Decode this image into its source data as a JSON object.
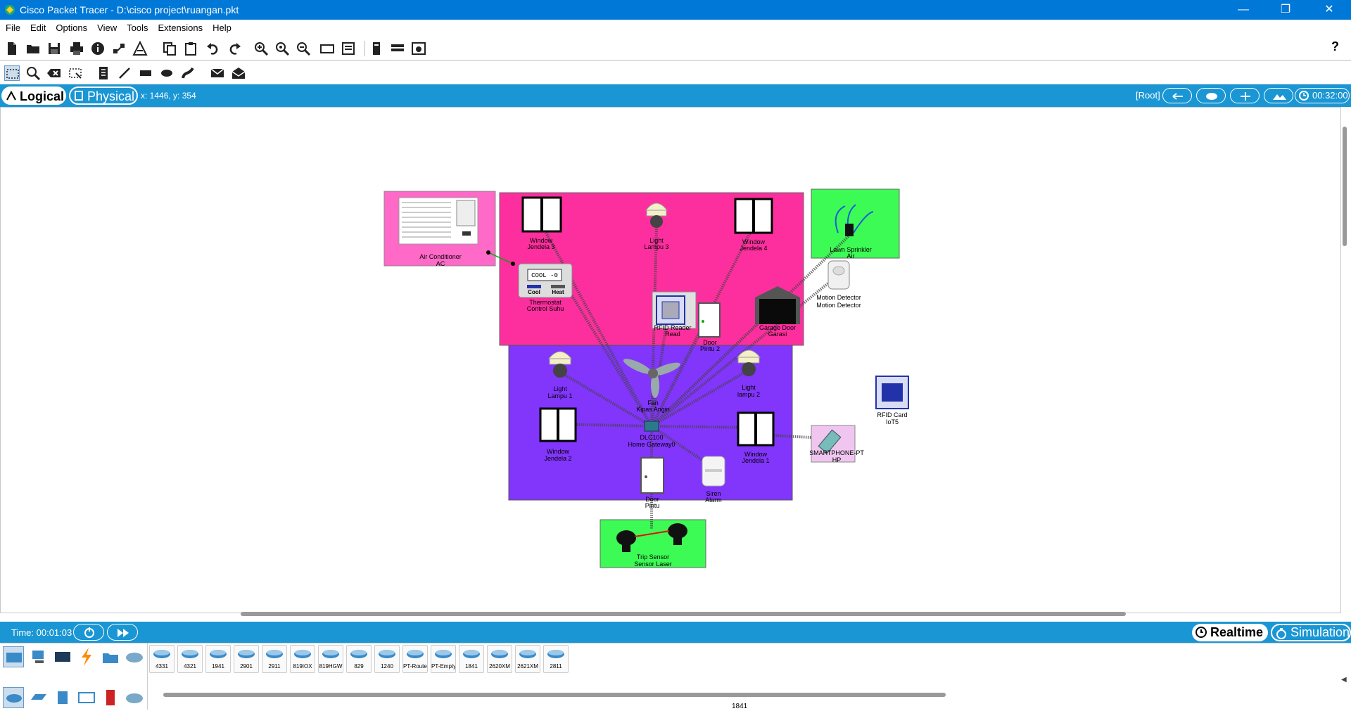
{
  "window": {
    "title": "Cisco Packet Tracer - D:\\cisco project\\ruangan.pkt",
    "minimize_glyph": "—",
    "restore_glyph": "❐",
    "close_glyph": "✕"
  },
  "menu": [
    "File",
    "Edit",
    "Options",
    "View",
    "Tools",
    "Extensions",
    "Help"
  ],
  "toolbar": {
    "help_glyph": "?",
    "icons": [
      "new-icon",
      "open-icon",
      "save-icon",
      "print-icon",
      "info-icon",
      "network-wizard-icon",
      "activity-wizard-icon",
      "copy-icon",
      "paste-icon",
      "undo-icon",
      "redo-icon",
      "zoom-in-icon",
      "zoom-reset-icon",
      "zoom-out-icon",
      "drawing-palette-icon",
      "custom-device-icon",
      "viewport-icon",
      "cluster-icon",
      "pdu-icon"
    ]
  },
  "toolbar2": {
    "icons": [
      "select-icon",
      "inspect-icon",
      "delete-icon",
      "resize-icon",
      "note-icon",
      "line-icon",
      "rectangle-icon",
      "ellipse-icon",
      "freeform-icon",
      "simple-pdu-icon",
      "complex-pdu-icon"
    ]
  },
  "modebar": {
    "logical_label": "Logical",
    "physical_label": "Physical",
    "coords": "x: 1446, y: 354",
    "root_label": "[Root]",
    "clock": "00:32:00"
  },
  "workspace": {
    "colors": {
      "pink": "#fd2f9e",
      "purple": "#8235fb",
      "green": "#3cfb55",
      "light_pink": "#ff69c8"
    },
    "devices": [
      {
        "name": "Air Conditioner",
        "sub": "AC"
      },
      {
        "name": "Window",
        "sub": "Jendela 3"
      },
      {
        "name": "Light",
        "sub": "Lampu 3"
      },
      {
        "name": "Window",
        "sub": "Jendela 4"
      },
      {
        "name": "Lawn Sprinkler",
        "sub": "Air"
      },
      {
        "name": "Thermostat",
        "sub": "Control Suhu",
        "screen": "COOL -0",
        "btn1": "Cool",
        "btn2": "Heat"
      },
      {
        "name": "RFID Reader",
        "sub": "Read"
      },
      {
        "name": "Door",
        "sub": "Pintu 2"
      },
      {
        "name": "Garage Door",
        "sub": "Garasi"
      },
      {
        "name": "Motion Detector",
        "sub": "Motion Detector"
      },
      {
        "name": "Light",
        "sub": "Lampu 1"
      },
      {
        "name": "Fan",
        "sub": "Kipas Angin"
      },
      {
        "name": "Light",
        "sub": "lampu 2"
      },
      {
        "name": "Window",
        "sub": "Jendela 2"
      },
      {
        "name": "DLC100",
        "sub": "Home Gateway0"
      },
      {
        "name": "Window",
        "sub": "Jendela 1"
      },
      {
        "name": "SMARTPHONE-PT",
        "sub": "HP"
      },
      {
        "name": "RFID Card",
        "sub": "IoT5"
      },
      {
        "name": "Door",
        "sub": "Pintu"
      },
      {
        "name": "Siren",
        "sub": "Alarm"
      },
      {
        "name": "Trip Sensor",
        "sub": "Sensor Laser"
      }
    ]
  },
  "timebar": {
    "time": "Time: 00:01:03",
    "realtime_label": "Realtime",
    "simulation_label": "Simulation"
  },
  "palette": {
    "categories": [
      "network-devices-icon",
      "end-devices-icon",
      "components-icon",
      "connections-icon",
      "misc-icon",
      "multiuser-icon"
    ],
    "subcategories": [
      "routers-icon",
      "switches-icon",
      "hubs-icon",
      "wireless-icon",
      "security-icon",
      "wan-emulation-icon"
    ],
    "devices": [
      "4331",
      "4321",
      "1941",
      "2901",
      "2911",
      "819IOX",
      "819HGW",
      "829",
      "1240",
      "PT-Router",
      "PT-Empty",
      "1841",
      "2620XM",
      "2621XM",
      "2811"
    ],
    "selected_model": "1841",
    "scroll_arrow": "◀"
  }
}
